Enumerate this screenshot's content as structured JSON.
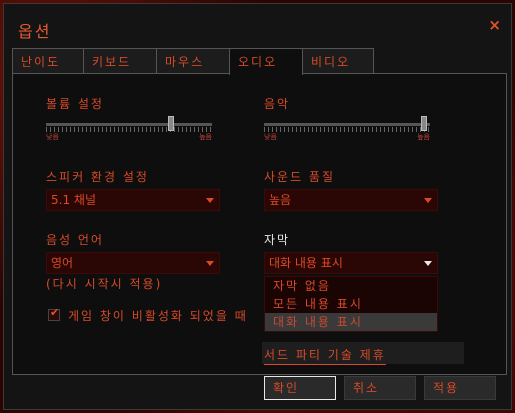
{
  "dialog": {
    "title": "옵션",
    "close_icon": "×"
  },
  "tabs": [
    {
      "label": "난이도",
      "active": false
    },
    {
      "label": "키보드",
      "active": false
    },
    {
      "label": "마우스",
      "active": false
    },
    {
      "label": "오디오",
      "active": true
    },
    {
      "label": "비디오",
      "active": false
    }
  ],
  "audio": {
    "volume": {
      "label": "볼륨 설정",
      "low": "낮음",
      "high": "높음",
      "level": 0.76
    },
    "music": {
      "label": "음악",
      "low": "낮음",
      "high": "높음",
      "level": 0.98
    },
    "speaker": {
      "label": "스피커 환경 설정",
      "value": "5.1 채널"
    },
    "sound_quality": {
      "label": "사운드 품질",
      "value": "높음"
    },
    "voice_language": {
      "label": "음성 언어",
      "value": "영어",
      "note": "(다시 시작시 적용)"
    },
    "subtitles": {
      "label": "자막",
      "value": "대화 내용 표시",
      "options": [
        "자막 없음",
        "모든 내용 표시",
        "대화 내용 표시"
      ],
      "selected_index": 2
    },
    "mute_inactive": {
      "label": "게임 창이 비활성화 되었을 때",
      "checked": true
    },
    "third_party": "서드 파티 기술 제휴"
  },
  "buttons": {
    "ok": "확인",
    "cancel": "취소",
    "apply": "적용"
  },
  "colors": {
    "accent": "#d84a28",
    "background": "#141414",
    "select_bg": "#2a0604"
  }
}
